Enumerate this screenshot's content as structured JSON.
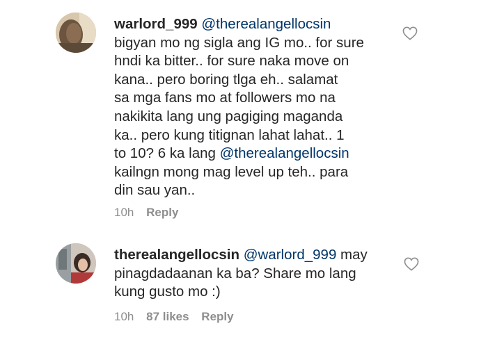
{
  "comments": [
    {
      "username": "warlord_999",
      "mention": "@therealangellocsin",
      "lines": [
        "bigyan mo ng sigla ang IG mo.. for sure",
        "hndi ka bitter.. for sure naka move on",
        "kana.. pero boring tlga eh.. salamat",
        "sa mga fans mo at followers mo na",
        "nakikita lang ung pagiging maganda",
        "ka.. pero kung titignan lahat lahat.. 1"
      ],
      "line7_text": "to 10? 6 ka lang ",
      "line7_mention": "@therealangellocsin",
      "lines_after": [
        "kailngn mong mag level up teh.. para",
        "din sau yan.."
      ],
      "time": "10h",
      "reply_label": "Reply",
      "like_icon": "heart-outline-icon"
    },
    {
      "username": "therealangellocsin",
      "mention": "@warlord_999",
      "first_line_suffix": " may",
      "lines": [
        "pinagdadaanan ka ba? Share mo lang",
        "kung gusto mo :)"
      ],
      "time": "10h",
      "likes": "87 likes",
      "reply_label": "Reply",
      "like_icon": "heart-outline-icon"
    }
  ],
  "colors": {
    "text": "#262626",
    "mention": "#003569",
    "meta": "#8e8e8e"
  }
}
